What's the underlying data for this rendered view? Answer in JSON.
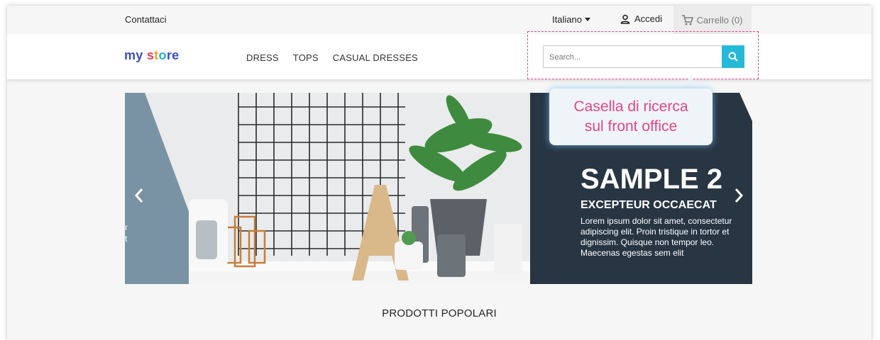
{
  "topbar": {
    "contact_label": "Contattaci",
    "language": "Italiano",
    "signin_label": "Accedi",
    "cart_label": "Carrello (0)"
  },
  "header": {
    "logo_text": "my store",
    "menu": [
      {
        "label": "DRESS"
      },
      {
        "label": "TOPS"
      },
      {
        "label": "CASUAL DRESSES"
      }
    ],
    "search": {
      "placeholder": "Search...",
      "value": ""
    }
  },
  "annotation": {
    "line1": "Casella di ricerca",
    "line2": "sul front office"
  },
  "slider": {
    "title": "SAMPLE 2",
    "subtitle": "EXCEPTEUR OCCAECAT",
    "body_lines": [
      "Lorem ipsum dolor sit amet, consectetur",
      "adipiscing elit. Proin tristique in tortor et",
      "dignissim. Quisque non tempor leo.",
      "Maecenas egestas sem elit"
    ],
    "left_cut_lines": [
      "r",
      "t"
    ]
  },
  "section_title": "PRODOTTI POPOLARI",
  "colors": {
    "accent": "#24b9d7",
    "annotation": "#e0468a",
    "banner_dark": "#283543"
  },
  "icons": {
    "user": "user-icon",
    "cart": "cart-icon",
    "search": "search-icon",
    "prev": "chevron-left-icon",
    "next": "chevron-right-icon"
  }
}
